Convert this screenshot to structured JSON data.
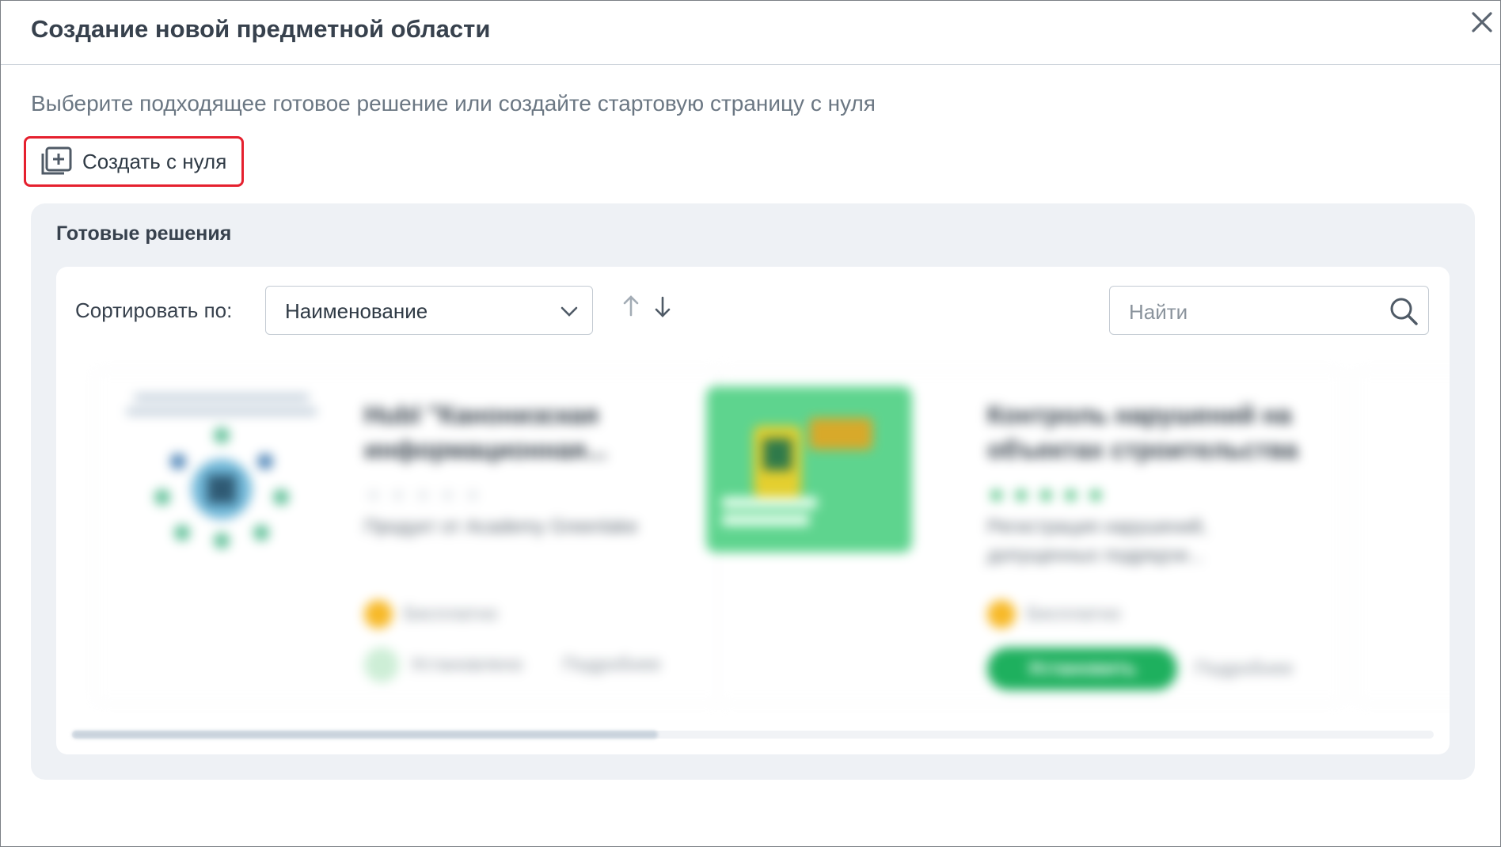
{
  "dialog": {
    "title": "Создание новой предметной области",
    "subtitle": "Выберите подходящее готовое решение или создайте стартовую страницу с нуля",
    "create_button_label": "Создать с нуля",
    "close_icon": "close-icon"
  },
  "ready_solutions": {
    "title": "Готовые решения",
    "sort_label": "Сортировать по:",
    "sort_value": "Наименование",
    "search_placeholder": "Найти"
  },
  "colors": {
    "highlight_border": "#e5202e",
    "install_green": "#1eb05e",
    "panel_bg": "#eef1f5"
  }
}
